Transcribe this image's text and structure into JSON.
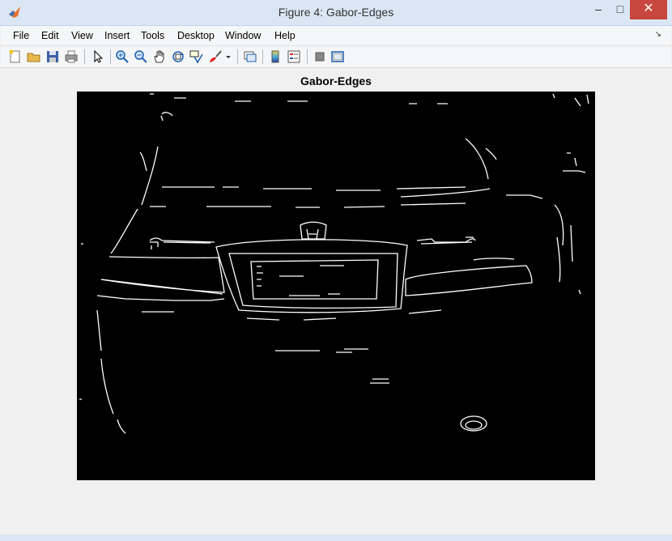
{
  "window": {
    "title": "Figure 4: Gabor-Edges",
    "icon": "matlab-icon"
  },
  "menu": [
    "File",
    "Edit",
    "View",
    "Insert",
    "Tools",
    "Desktop",
    "Window",
    "Help"
  ],
  "toolbar": [
    "new-figure-icon",
    "open-file-icon",
    "save-icon",
    "print-icon",
    "pointer-icon",
    "zoom-in-icon",
    "zoom-out-icon",
    "pan-icon",
    "rotate-3d-icon",
    "data-cursor-icon",
    "brush-icon",
    "brush-dropdown-icon",
    "link-plot-icon",
    "colorbar-icon",
    "legend-icon",
    "hide-plot-tools-icon",
    "show-plot-tools-icon"
  ],
  "axes": {
    "title": "Gabor-Edges"
  },
  "image": {
    "content": "edge-detection-image",
    "colors": {
      "background": "#000000",
      "edges": "#ffffff"
    }
  }
}
